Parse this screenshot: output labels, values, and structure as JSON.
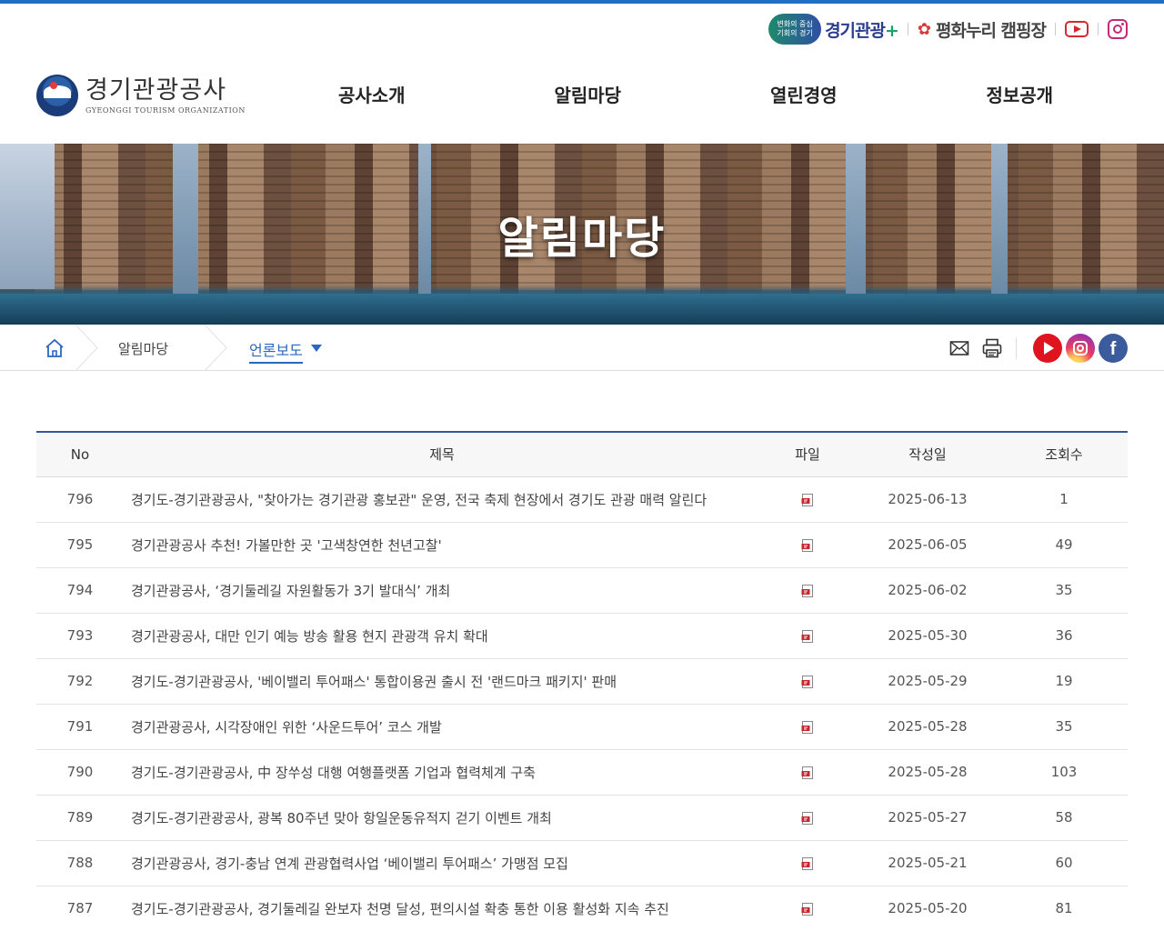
{
  "util": {
    "badge_line1": "변화의 중심",
    "badge_line2": "기회의 경기",
    "gg_brand": "경기관광",
    "gg_plus": "+",
    "camp_label": "평화누리 캠핑장",
    "youtube_icon": "youtube-icon",
    "instagram_icon": "instagram-icon"
  },
  "logo": {
    "name_ko": "경기관광공사",
    "name_en": "GYEONGGI TOURISM ORGANIZATION"
  },
  "gnb": [
    "공사소개",
    "알림마당",
    "열린경영",
    "정보공개"
  ],
  "banner": {
    "title": "알림마당"
  },
  "location": {
    "crumb1": "알림마당",
    "crumb2": "언론보도"
  },
  "colors": {
    "accent": "#2a67c1",
    "top_line": "#1f6fc4",
    "table_top": "#2c5a9a",
    "youtube": "#e0141e",
    "facebook": "#3b5b9c"
  },
  "table": {
    "headers": {
      "no": "No",
      "title": "제목",
      "file": "파일",
      "date": "작성일",
      "views": "조회수"
    },
    "rows": [
      {
        "no": "796",
        "title": "경기도-경기관광공사, \"찾아가는 경기관광 홍보관\" 운영, 전국 축제 현장에서 경기도 관광 매력 알린다",
        "date": "2025-06-13",
        "views": "1"
      },
      {
        "no": "795",
        "title": "경기관광공사 추천! 가볼만한 곳 '고색창연한 천년고찰'",
        "date": "2025-06-05",
        "views": "49"
      },
      {
        "no": "794",
        "title": "경기관광공사, ‘경기둘레길 자원활동가 3기 발대식’ 개최",
        "date": "2025-06-02",
        "views": "35"
      },
      {
        "no": "793",
        "title": "경기관광공사, 대만 인기 예능 방송 활용 현지 관광객 유치 확대",
        "date": "2025-05-30",
        "views": "36"
      },
      {
        "no": "792",
        "title": "경기도-경기관광공사, '베이밸리 투어패스' 통합이용권 출시 전 '랜드마크 패키지' 판매",
        "date": "2025-05-29",
        "views": "19"
      },
      {
        "no": "791",
        "title": "경기관광공사, 시각장애인 위한 ‘사운드투어’ 코스 개발",
        "date": "2025-05-28",
        "views": "35"
      },
      {
        "no": "790",
        "title": "경기도-경기관광공사, 中 장쑤성 대행 여행플랫폼 기업과 협력체계 구축",
        "date": "2025-05-28",
        "views": "103"
      },
      {
        "no": "789",
        "title": "경기도-경기관광공사, 광복 80주년 맞아 항일운동유적지 걷기 이벤트 개최",
        "date": "2025-05-27",
        "views": "58"
      },
      {
        "no": "788",
        "title": "경기관광공사, 경기-충남 연계 관광협력사업 ‘베이밸리 투어패스’ 가맹점 모집",
        "date": "2025-05-21",
        "views": "60"
      },
      {
        "no": "787",
        "title": "경기도-경기관광공사, 경기둘레길 완보자 천명 달성, 편의시설 확충 통한 이용 활성화 지속 추진",
        "date": "2025-05-20",
        "views": "81"
      }
    ]
  }
}
